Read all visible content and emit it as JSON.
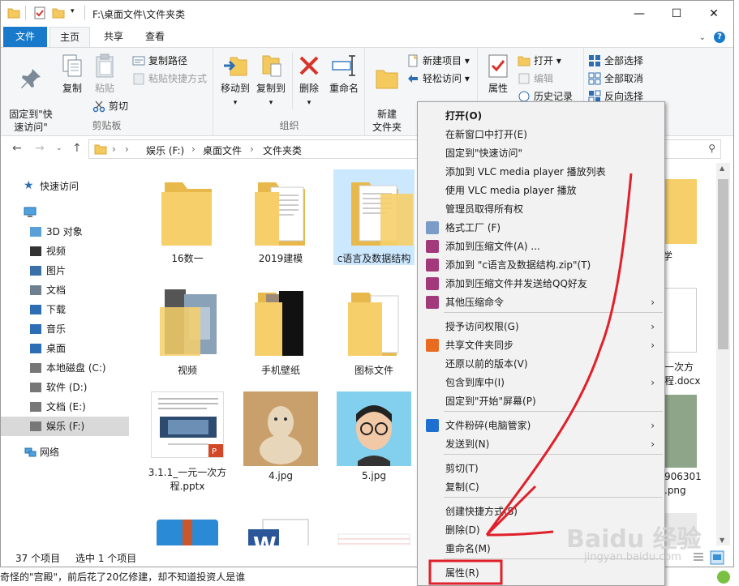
{
  "window": {
    "title": "F:\\桌面文件\\文件夹类",
    "minimize": "—",
    "maximize": "☐",
    "close": "✕"
  },
  "ribbon_tabs": [
    "文件",
    "主页",
    "共享",
    "查看"
  ],
  "ribbon": {
    "clipboard": {
      "group_label": "剪贴板",
      "pin_label": "固定到\"快\n速访问\"",
      "copy_label": "复制",
      "paste_label": "粘贴",
      "copy_path": "复制路径",
      "paste_shortcut": "粘贴快捷方式",
      "cut": "剪切"
    },
    "organize": {
      "group_label": "组织",
      "move_to": "移动到",
      "copy_to": "复制到",
      "delete": "删除",
      "rename": "重命名"
    },
    "new": {
      "group_label": "新",
      "new_folder": "新建\n文件夹",
      "new_item": "新建项目 ▾",
      "easy_access": "轻松访问 ▾"
    },
    "open": {
      "properties": "属性",
      "open": "打开 ▾",
      "edit": "编辑",
      "history": "历史记录"
    },
    "select": {
      "select_all": "全部选择",
      "select_none": "全部取消",
      "invert": "反向选择"
    }
  },
  "address": {
    "parts": [
      "娱乐 (F:)",
      "桌面文件",
      "文件夹类"
    ],
    "separators": [
      "›",
      "›",
      "›",
      "›"
    ]
  },
  "nav_pane": {
    "quick_access": "快速访问",
    "this_pc_items": [
      "3D 对象",
      "视频",
      "图片",
      "文档",
      "下载",
      "音乐",
      "桌面",
      "本地磁盘 (C:)",
      "软件 (D:)",
      "文档 (E:)",
      "娱乐 (F:)"
    ],
    "network": "网络"
  },
  "files": [
    {
      "name": "16数一"
    },
    {
      "name": "2019建模"
    },
    {
      "name": "c语言及数据结构"
    },
    {
      "name": "视频"
    },
    {
      "name": "手机壁纸"
    },
    {
      "name": "图标文件"
    },
    {
      "name": "3.1.1_一元一次方\n程.pptx"
    },
    {
      "name": "4.jpg"
    },
    {
      "name": "5.jpg"
    }
  ],
  "right_edge_labels": [
    "学",
    "一次方",
    "程.docx",
    "906301",
    ".png"
  ],
  "status": {
    "item_count": "37 个项目",
    "selected": "选中 1 个项目"
  },
  "context_menu": {
    "items": [
      {
        "label": "打开(O)",
        "bold": true
      },
      {
        "label": "在新窗口中打开(E)"
      },
      {
        "label": "固定到\"快速访问\""
      },
      {
        "label": "添加到 VLC media player 播放列表"
      },
      {
        "label": "使用 VLC media player 播放"
      },
      {
        "label": "管理员取得所有权"
      },
      {
        "label": "格式工厂 (F)",
        "icon": "format-factory-icon"
      },
      {
        "label": "添加到压缩文件(A) ...",
        "icon": "winrar-icon"
      },
      {
        "label": "添加到 \"c语言及数据结构.zip\"(T)",
        "icon": "winrar-icon"
      },
      {
        "label": "添加到压缩文件并发送给QQ好友",
        "icon": "winrar-icon"
      },
      {
        "label": "其他压缩命令",
        "icon": "winrar-icon",
        "submenu": true
      },
      {
        "label": "授予访问权限(G)",
        "submenu": true
      },
      {
        "label": "共享文件夹同步",
        "icon": "sync-icon",
        "submenu": true
      },
      {
        "label": "还原以前的版本(V)"
      },
      {
        "label": "包含到库中(I)",
        "submenu": true
      },
      {
        "label": "固定到\"开始\"屏幕(P)"
      },
      {
        "label": "文件粉碎(电脑管家)",
        "icon": "shield-icon",
        "submenu": true
      },
      {
        "label": "发送到(N)",
        "submenu": true
      },
      {
        "label": "剪切(T)"
      },
      {
        "label": "复制(C)"
      },
      {
        "label": "创建快捷方式(S)"
      },
      {
        "label": "删除(D)"
      },
      {
        "label": "重命名(M)"
      },
      {
        "label": "属性(R)"
      }
    ]
  },
  "ticker_text": "奇怪的\"宫殿\"，前后花了20亿修建，却不知道投资人是谁",
  "watermark": {
    "main": "Baidu 经验",
    "sub": "jingyan.baidu.com"
  },
  "colors": {
    "accent": "#1979ca",
    "selection": "#cce8ff",
    "annotation": "#e0202a",
    "folder": "#f4c95d"
  }
}
